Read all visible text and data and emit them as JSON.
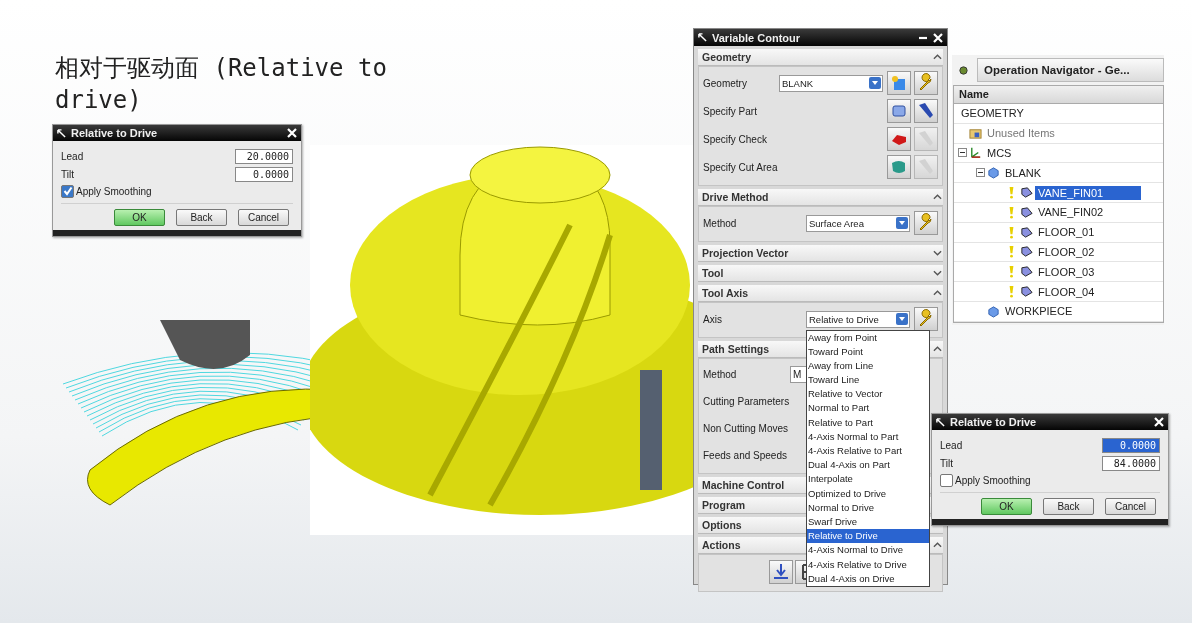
{
  "slide_title": "相对于驱动面 (Relative to drive)",
  "dialog_left": {
    "title": "Relative to Drive",
    "fields": [
      {
        "label": "Lead",
        "value": "20.0000",
        "selected": false
      },
      {
        "label": "Tilt",
        "value": "0.0000",
        "selected": false
      }
    ],
    "checkbox": {
      "label": "Apply Smoothing",
      "checked": true
    },
    "buttons": [
      "OK",
      "Back",
      "Cancel"
    ]
  },
  "variable_contour": {
    "title": "Variable Contour",
    "sections": [
      {
        "title": "Geometry",
        "expanded": true,
        "rows": [
          {
            "kind": "select",
            "label": "Geometry",
            "value": "BLANK",
            "icons": [
              {
                "kind": "cube",
                "disabled": false
              },
              {
                "kind": "wrench",
                "disabled": false
              }
            ]
          },
          {
            "kind": "icons",
            "label": "Specify Part",
            "icons": [
              {
                "kind": "part",
                "disabled": false
              },
              {
                "kind": "flashlight",
                "disabled": false
              }
            ]
          },
          {
            "kind": "icons",
            "label": "Specify Check",
            "icons": [
              {
                "kind": "check",
                "disabled": false
              },
              {
                "kind": "flashlight",
                "disabled": true
              }
            ]
          },
          {
            "kind": "icons",
            "label": "Specify Cut Area",
            "icons": [
              {
                "kind": "cutarea",
                "disabled": false
              },
              {
                "kind": "flashlight",
                "disabled": true
              }
            ]
          }
        ]
      },
      {
        "title": "Drive Method",
        "expanded": true,
        "rows": [
          {
            "kind": "select",
            "label": "Method",
            "value": "Surface Area",
            "icons": [
              {
                "kind": "wrench",
                "disabled": false
              }
            ]
          }
        ]
      },
      {
        "title": "Projection Vector",
        "expanded": false
      },
      {
        "title": "Tool",
        "expanded": false
      },
      {
        "title": "Tool Axis",
        "expanded": true,
        "rows": [
          {
            "kind": "select",
            "label": "Axis",
            "value": "Relative to Drive",
            "icons": [
              {
                "kind": "wrench",
                "disabled": false
              }
            ],
            "options": [
              {
                "label": "Away from Point",
                "selected": false
              },
              {
                "label": "Toward Point",
                "selected": false
              },
              {
                "label": "Away from Line",
                "selected": false
              },
              {
                "label": "Toward Line",
                "selected": false
              },
              {
                "label": "Relative to Vector",
                "selected": false
              },
              {
                "label": "Normal to Part",
                "selected": false
              },
              {
                "label": "Relative to Part",
                "selected": false
              },
              {
                "label": "4-Axis Normal to Part",
                "selected": false
              },
              {
                "label": "4-Axis Relative to Part",
                "selected": false
              },
              {
                "label": "Dual 4-Axis on Part",
                "selected": false
              },
              {
                "label": "Interpolate",
                "selected": false
              },
              {
                "label": "Optimized to Drive",
                "selected": false
              },
              {
                "label": "Normal to Drive",
                "selected": false
              },
              {
                "label": "Swarf Drive",
                "selected": false
              },
              {
                "label": "Relative to Drive",
                "selected": true
              },
              {
                "label": "4-Axis Normal to Drive",
                "selected": false
              },
              {
                "label": "4-Axis Relative to Drive",
                "selected": false
              },
              {
                "label": "Dual 4-Axis on Drive",
                "selected": false
              }
            ]
          }
        ]
      },
      {
        "title": "Path Settings",
        "expanded": true,
        "rows": [
          {
            "kind": "field",
            "label": "Method",
            "value": "M"
          },
          {
            "kind": "label",
            "label": "Cutting Parameters"
          },
          {
            "kind": "label",
            "label": "Non Cutting Moves"
          },
          {
            "kind": "label",
            "label": "Feeds and Speeds"
          }
        ]
      },
      {
        "title": "Machine Control"
      },
      {
        "title": "Program"
      },
      {
        "title": "Options"
      },
      {
        "title": "Actions",
        "expanded": true,
        "rows": [
          {
            "kind": "actions",
            "icons": [
              {
                "kind": "generate"
              },
              {
                "kind": "replay"
              }
            ]
          }
        ]
      }
    ]
  },
  "navigator": {
    "title": "Operation Navigator - Ge...",
    "column": "Name",
    "tree": [
      {
        "label": "GEOMETRY",
        "selected": false,
        "children": [
          {
            "label": "Unused Items",
            "kind": "folder",
            "selected": false
          },
          {
            "label": "MCS",
            "kind": "mcs",
            "selected": false,
            "expanded": true,
            "children": [
              {
                "label": "BLANK",
                "kind": "blank",
                "selected": false,
                "expanded": true,
                "children": [
                  {
                    "label": "VANE_FIN01",
                    "kind": "geom",
                    "selected": true
                  },
                  {
                    "label": "VANE_FIN02",
                    "kind": "geom",
                    "selected": false
                  },
                  {
                    "label": "FLOOR_01",
                    "kind": "geom",
                    "selected": false
                  },
                  {
                    "label": "FLOOR_02",
                    "kind": "geom",
                    "selected": false
                  },
                  {
                    "label": "FLOOR_03",
                    "kind": "geom",
                    "selected": false
                  },
                  {
                    "label": "FLOOR_04",
                    "kind": "geom",
                    "selected": false
                  }
                ]
              },
              {
                "label": "WORKPIECE",
                "kind": "blank",
                "selected": false
              }
            ]
          }
        ]
      }
    ]
  },
  "dialog_right": {
    "title": "Relative to Drive",
    "fields": [
      {
        "label": "Lead",
        "value": "0.0000",
        "selected": true
      },
      {
        "label": "Tilt",
        "value": "84.0000",
        "selected": false
      }
    ],
    "checkbox": {
      "label": "Apply Smoothing",
      "checked": false
    },
    "buttons": [
      "OK",
      "Back",
      "Cancel"
    ]
  }
}
